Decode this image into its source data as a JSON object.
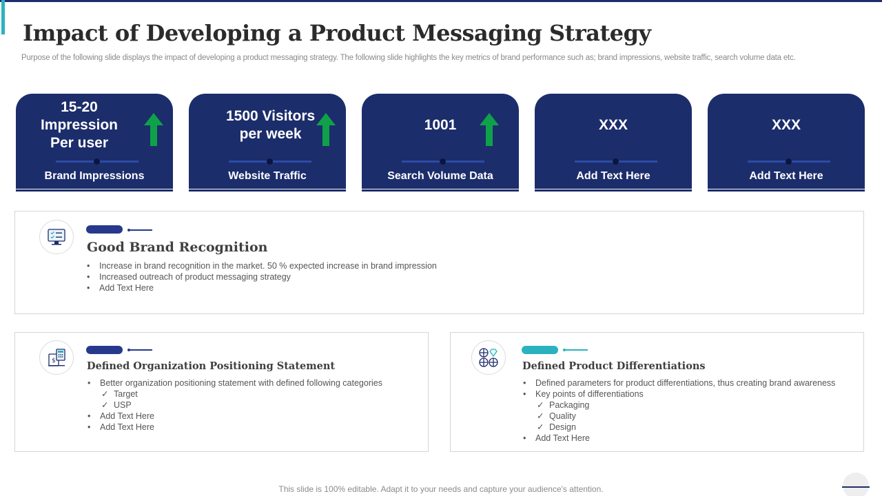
{
  "slide": {
    "title": "Impact of Developing a Product Messaging Strategy",
    "subtitle": "Purpose of the following slide displays the impact of developing a product messaging strategy. The following slide highlights the key metrics of brand performance such as; brand impressions, website traffic, search volume data etc."
  },
  "colors": {
    "card_fill": "#1c2d6b",
    "arrow_green": "#0fa14a",
    "accent_teal": "#2ab3bf",
    "accent_navy": "#1f2d6e"
  },
  "metric_cards": [
    {
      "value": "15-20\nImpression\nPer user",
      "label": "Brand Impressions",
      "trend": "up-arrow-icon"
    },
    {
      "value": "1500 Visitors\nper week",
      "label": "Website Traffic",
      "trend": "up-arrow-icon"
    },
    {
      "value": "1001",
      "label": "Search Volume Data",
      "trend": "up-arrow-icon"
    },
    {
      "value": "XXX",
      "label": "Add Text Here",
      "trend": ""
    },
    {
      "value": "XXX",
      "label": "Add Text Here",
      "trend": ""
    }
  ],
  "panels": {
    "brand_recognition": {
      "icon": "monitor-checklist-icon",
      "heading": "Good Brand Recognition",
      "bullets": [
        "Increase in brand recognition in the market. 50 % expected increase in brand impression",
        "Increased outreach of product messaging strategy",
        "Add Text Here"
      ]
    },
    "positioning": {
      "icon": "calculator-document-icon",
      "heading": "Defined Organization Positioning Statement",
      "bullets": [
        "Better organization positioning statement with defined following categories"
      ],
      "checks": [
        "Target",
        "USP"
      ],
      "bullets_after": [
        "Add Text Here",
        "Add Text Here"
      ]
    },
    "differentiation": {
      "icon": "globe-diamond-icon",
      "heading": "Defined Product Differentiations",
      "bullets": [
        "Defined parameters for product differentiations, thus creating brand awareness",
        "Key points of differentiations"
      ],
      "checks": [
        "Packaging",
        "Quality",
        "Design"
      ],
      "bullets_after": [
        "Add Text Here"
      ]
    }
  },
  "footer": {
    "note": "This slide is 100% editable. Adapt it to your needs and capture your audience's attention."
  }
}
